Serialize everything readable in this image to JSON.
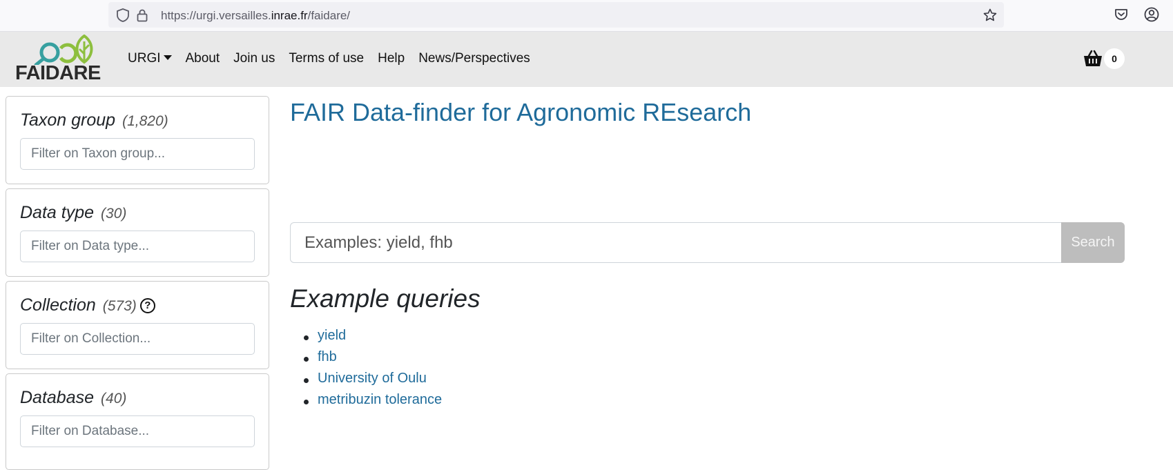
{
  "browser": {
    "url_prefix": "https://urgi.versailles.",
    "url_host": "inrae.fr",
    "url_path": "/faidare/"
  },
  "navbar": {
    "logo_text": "FAIDARE",
    "links": [
      "URGI",
      "About",
      "Join us",
      "Terms of use",
      "Help",
      "News/Perspectives"
    ],
    "cart_count": "0"
  },
  "sidebar": {
    "facets": [
      {
        "title": "Taxon group",
        "count": "(1,820)",
        "placeholder": "Filter on Taxon group..."
      },
      {
        "title": "Data type",
        "count": "(30)",
        "placeholder": "Filter on Data type..."
      },
      {
        "title": "Collection",
        "count": "(573)",
        "placeholder": "Filter on Collection..."
      },
      {
        "title": "Database",
        "count": "(40)",
        "placeholder": "Filter on Database..."
      }
    ]
  },
  "main": {
    "title": "FAIR Data-finder for Agronomic REsearch",
    "search_placeholder": "Examples: yield, fhb",
    "search_button": "Search",
    "examples_title": "Example queries",
    "examples": [
      "yield",
      "fhb",
      "University of Oulu",
      "metribuzin tolerance"
    ]
  },
  "colors": {
    "link": "#1f6b9a",
    "navbar_bg": "#e9e9e9",
    "search_button_bg": "#bdbdbd"
  }
}
